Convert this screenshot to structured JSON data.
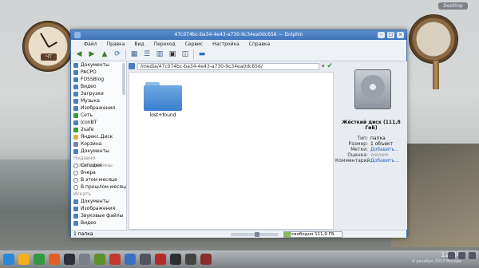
{
  "desktop": {
    "top_right_label": "Desktop",
    "clock_day": "ЧТ"
  },
  "window": {
    "title": "47c074bc-ba34-4e43-a730-9c34ea0dc656 — Dolphin",
    "menu": [
      "Файл",
      "Правка",
      "Вид",
      "Переход",
      "Сервис",
      "Настройка",
      "Справка"
    ],
    "address": "/media/47c074bc-ba34-4e43-a730-9c34ea0dc656/"
  },
  "sidebar": {
    "items": [
      {
        "label": "Документы",
        "color": "#4a7fc2"
      },
      {
        "label": "PACPO",
        "color": "#4a7fc2"
      },
      {
        "label": "FOSSBlog",
        "color": "#4a7fc2"
      },
      {
        "label": "Видео",
        "color": "#4a7fc2"
      },
      {
        "label": "Загрузки",
        "color": "#4a7fc2"
      },
      {
        "label": "Музыка",
        "color": "#4a7fc2"
      },
      {
        "label": "Изображения",
        "color": "#4a7fc2"
      },
      {
        "label": "Сеть",
        "color": "#3a9a3a"
      },
      {
        "label": "IconBT",
        "color": "#4a7fc2"
      },
      {
        "label": "2safe",
        "color": "#3a9a3a"
      },
      {
        "label": "Яндекс.Диск",
        "color": "#d2b24a"
      },
      {
        "label": "Корзина",
        "color": "#7d8794"
      },
      {
        "label": "Документы",
        "color": "#4a7fc2"
      }
    ],
    "recent_header": "Недавно использованны",
    "recent": [
      "Сегодня",
      "Вчера",
      "В этом месяце",
      "В прошлом месяце"
    ],
    "search_header": "Искать",
    "search": [
      {
        "label": "Документы",
        "color": "#4a7fc2"
      },
      {
        "label": "Изображения",
        "color": "#4a7fc2"
      },
      {
        "label": "Звуковые файлы",
        "color": "#4a7fc2"
      },
      {
        "label": "Видео",
        "color": "#4a7fc2"
      }
    ]
  },
  "content": {
    "folder_name": "lost+found"
  },
  "info": {
    "title": "Жёсткий диск (111,8 ГиБ)",
    "rows": [
      {
        "k": "Тип:",
        "v": "папка",
        "link": false
      },
      {
        "k": "Размер:",
        "v": "1 объект",
        "link": false
      },
      {
        "k": "Метки:",
        "v": "Добавить...",
        "link": true
      },
      {
        "k": "Оценка:",
        "v": "☆☆☆☆☆",
        "link": false
      },
      {
        "k": "Комментарий:",
        "v": "Добавить...",
        "link": true
      }
    ]
  },
  "status": {
    "count": "1 папка",
    "free": "свободно 111,9 ГБ"
  },
  "taskbar": {
    "time": "12:36",
    "date": "6 декабря 2013 Москва",
    "icons": [
      "#2a88d8",
      "#f2b11b",
      "#2f9a3f",
      "#e35d26",
      "#2e2e3a",
      "#7a7f88",
      "#5b8f2a",
      "#c23a2e",
      "#3a6fc2",
      "#505560",
      "#b52a2a",
      "#2e2e2e",
      "#444",
      "#8a2d2d"
    ]
  }
}
